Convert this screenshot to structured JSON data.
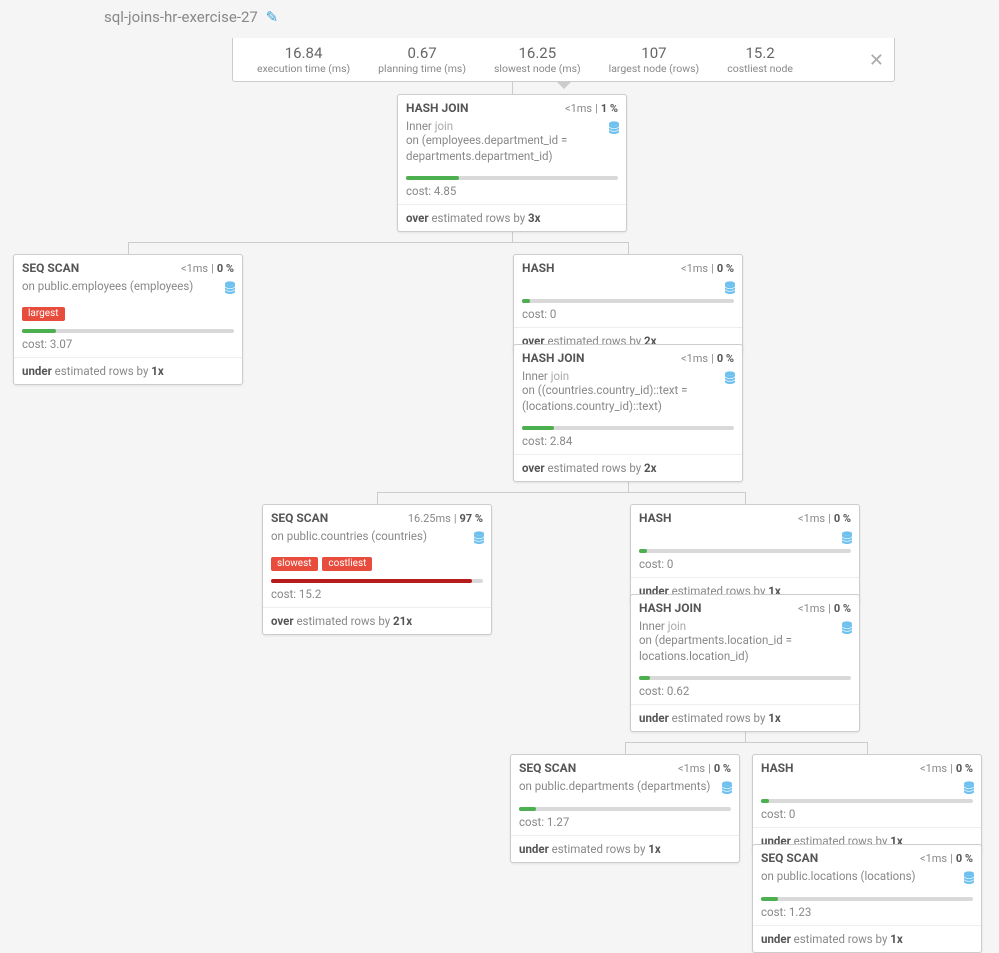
{
  "title": "sql-joins-hr-exercise-27",
  "summary": [
    {
      "value": "16.84",
      "label": "execution time (ms)"
    },
    {
      "value": "0.67",
      "label": "planning time (ms)"
    },
    {
      "value": "16.25",
      "label": "slowest node (ms)"
    },
    {
      "value": "107",
      "label": "largest node (rows)"
    },
    {
      "value": "15.2",
      "label": "costliest node"
    }
  ],
  "close": "✕",
  "nodes": {
    "root": {
      "title": "HASH JOIN",
      "time": "<1ms",
      "pct": "1 %",
      "body1": "Inner ",
      "body1_muted": "join",
      "on": "on (employees.department_id = departments.department_id)",
      "bar_pct": 25,
      "bar_class": "bar-green",
      "cost_label": "cost:",
      "cost": " 4.85",
      "est_dir": "over",
      "est_mid": " estimated rows by ",
      "est_x": "3x"
    },
    "seq_emp": {
      "title": "SEQ SCAN",
      "time": "<1ms",
      "pct": "0 %",
      "on": "on public.employees (employees)",
      "tags": [
        "largest"
      ],
      "bar_pct": 16,
      "bar_class": "bar-green",
      "cost_label": "cost:",
      "cost": " 3.07",
      "est_dir": "under",
      "est_mid": " estimated rows by ",
      "est_x": "1x"
    },
    "hash1": {
      "title": "HASH",
      "time": "<1ms",
      "pct": "0 %",
      "bar_pct": 4,
      "bar_class": "bar-green",
      "cost_label": "cost:",
      "cost": " 0",
      "est_dir": "over",
      "est_mid": " estimated rows by ",
      "est_x": "2x"
    },
    "hj_countries": {
      "title": "HASH JOIN",
      "time": "<1ms",
      "pct": "0 %",
      "body1": "Inner ",
      "body1_muted": "join",
      "on": "on ((countries.country_id)::text = (locations.country_id)::text)",
      "bar_pct": 15,
      "bar_class": "bar-green",
      "cost_label": "cost:",
      "cost": " 2.84",
      "est_dir": "over",
      "est_mid": " estimated rows by ",
      "est_x": "2x"
    },
    "seq_countries": {
      "title": "SEQ SCAN",
      "time": "16.25ms",
      "pct": "97 %",
      "on": "on public.countries (countries)",
      "tags": [
        "slowest",
        "costliest"
      ],
      "bar_pct": 95,
      "bar_class": "bar-red",
      "cost_label": "cost:",
      "cost": " 15.2",
      "est_dir": "over",
      "est_mid": " estimated rows by ",
      "est_x": "21x"
    },
    "hash2": {
      "title": "HASH",
      "time": "<1ms",
      "pct": "0 %",
      "bar_pct": 4,
      "bar_class": "bar-green",
      "cost_label": "cost:",
      "cost": " 0",
      "est_dir": "under",
      "est_mid": " estimated rows by ",
      "est_x": "1x"
    },
    "hj_dept": {
      "title": "HASH JOIN",
      "time": "<1ms",
      "pct": "0 %",
      "body1": "Inner ",
      "body1_muted": "join",
      "on": "on (departments.location_id = locations.location_id)",
      "bar_pct": 5,
      "bar_class": "bar-green",
      "cost_label": "cost:",
      "cost": " 0.62",
      "est_dir": "under",
      "est_mid": " estimated rows by ",
      "est_x": "1x"
    },
    "seq_dept": {
      "title": "SEQ SCAN",
      "time": "<1ms",
      "pct": "0 %",
      "on": "on public.departments (departments)",
      "bar_pct": 8,
      "bar_class": "bar-green",
      "cost_label": "cost:",
      "cost": " 1.27",
      "est_dir": "under",
      "est_mid": " estimated rows by ",
      "est_x": "1x"
    },
    "hash3": {
      "title": "HASH",
      "time": "<1ms",
      "pct": "0 %",
      "bar_pct": 4,
      "bar_class": "bar-green",
      "cost_label": "cost:",
      "cost": " 0",
      "est_dir": "under",
      "est_mid": " estimated rows by ",
      "est_x": "1x"
    },
    "seq_loc": {
      "title": "SEQ SCAN",
      "time": "<1ms",
      "pct": "0 %",
      "on": "on public.locations (locations)",
      "bar_pct": 8,
      "bar_class": "bar-green",
      "cost_label": "cost:",
      "cost": " 1.23",
      "est_dir": "under",
      "est_mid": " estimated rows by ",
      "est_x": "1x"
    }
  }
}
